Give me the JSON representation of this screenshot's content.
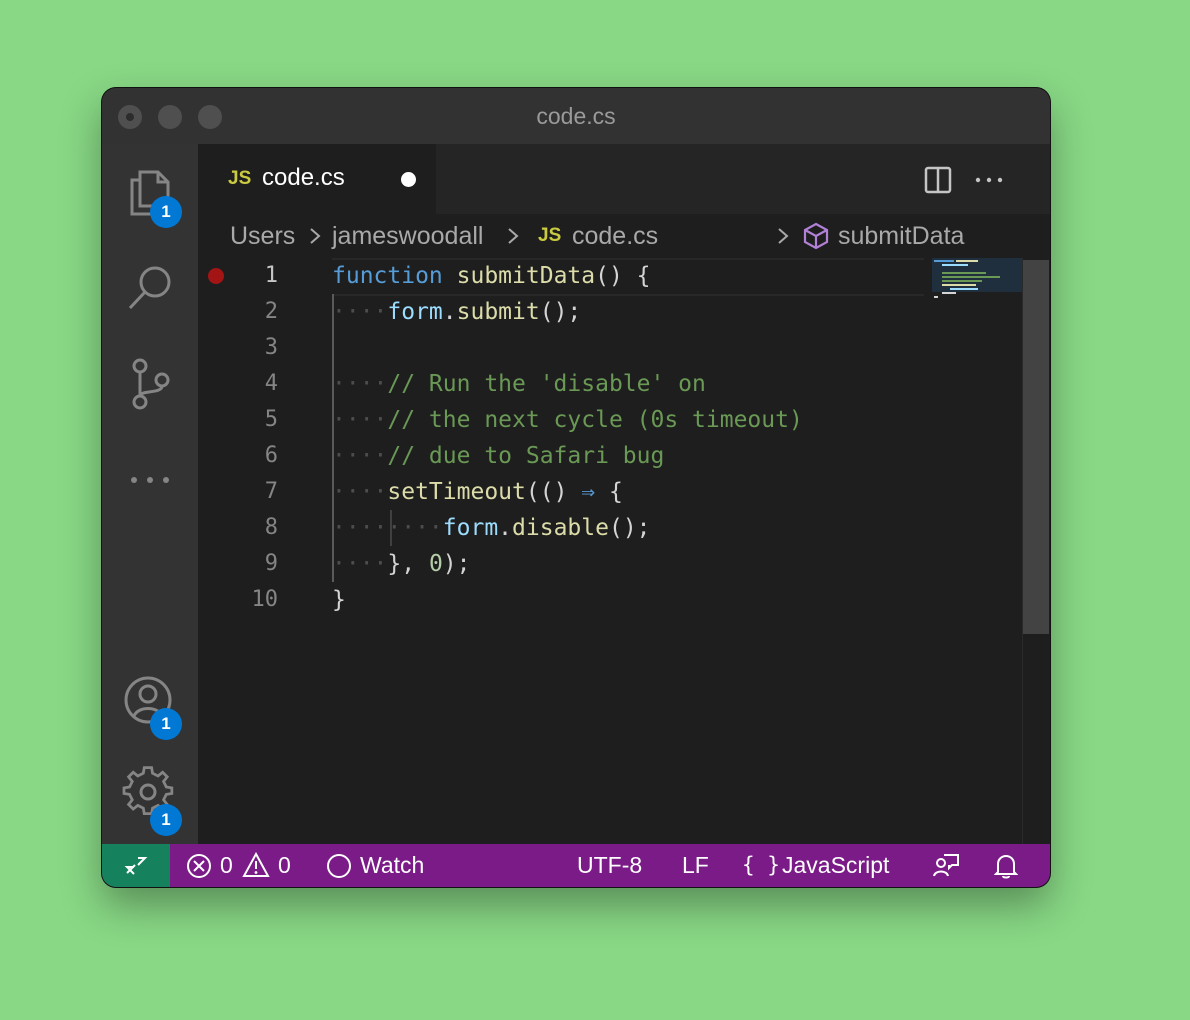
{
  "window": {
    "title": "code.cs"
  },
  "activity_bar": {
    "explorer_badge": "1",
    "accounts_badge": "1",
    "settings_badge": "1"
  },
  "tab": {
    "lang_badge": "JS",
    "label": "code.cs"
  },
  "breadcrumb": {
    "items": [
      "Users",
      "jameswoodall",
      "code.cs",
      "submitData"
    ],
    "lang_badge": "JS"
  },
  "editor": {
    "line_numbers": [
      "1",
      "2",
      "3",
      "4",
      "5",
      "6",
      "7",
      "8",
      "9",
      "10"
    ],
    "lines": [
      "function submitData() {",
      "    form.submit();",
      "",
      "    // Run the 'disable' on",
      "    // the next cycle (0s timeout)",
      "    // due to Safari bug",
      "    setTimeout(() ⇒ {",
      "        form.disable();",
      "    }, 0);",
      "}"
    ]
  },
  "statusbar": {
    "errors": "0",
    "warnings": "0",
    "watch_label": "Watch",
    "encoding": "UTF-8",
    "line_ending": "LF",
    "language_icon": "{ }",
    "language": "JavaScript"
  },
  "colors": {
    "statusbar_bg": "#7a1b87",
    "remote_bg": "#16825d",
    "badge_bg": "#0078d4",
    "breakpoint": "#a31515"
  }
}
